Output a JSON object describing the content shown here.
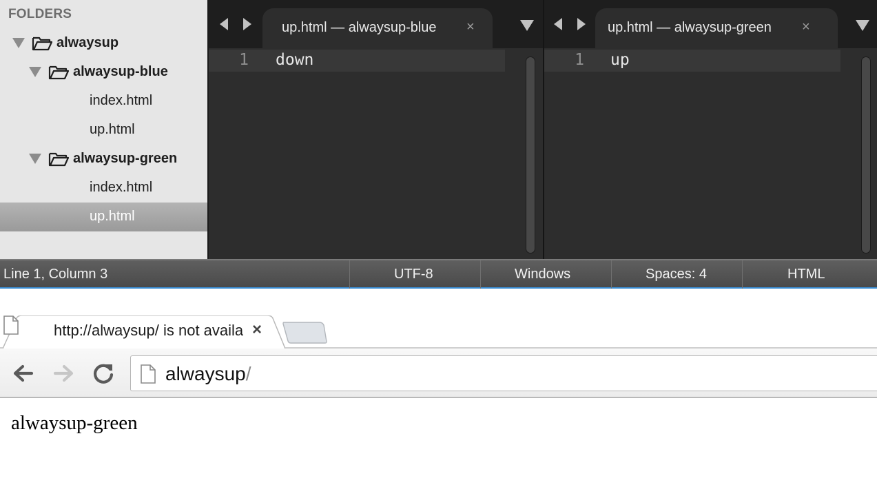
{
  "editor": {
    "sidebar": {
      "heading": "FOLDERS",
      "tree": [
        {
          "label": "alwaysup",
          "type": "folder",
          "expanded": true,
          "depth": 0
        },
        {
          "label": "alwaysup-blue",
          "type": "folder",
          "expanded": true,
          "depth": 1
        },
        {
          "label": "index.html",
          "type": "file",
          "depth": 2
        },
        {
          "label": "up.html",
          "type": "file",
          "depth": 2
        },
        {
          "label": "alwaysup-green",
          "type": "folder",
          "expanded": true,
          "depth": 1
        },
        {
          "label": "index.html",
          "type": "file",
          "depth": 2
        },
        {
          "label": "up.html",
          "type": "file",
          "depth": 2,
          "selected": true
        }
      ]
    },
    "panes": [
      {
        "tab_title": "up.html — alwaysup-blue",
        "close_glyph": "×",
        "line_number": "1",
        "code": "down"
      },
      {
        "tab_title": "up.html — alwaysup-green",
        "close_glyph": "×",
        "line_number": "1",
        "code": "up"
      }
    ],
    "statusbar": {
      "position": "Line 1, Column 3",
      "encoding": "UTF-8",
      "line_endings": "Windows",
      "indentation": "Spaces: 4",
      "syntax": "HTML"
    }
  },
  "browser": {
    "tab": {
      "title": "http://alwaysup/ is not available",
      "close_glyph": "×"
    },
    "omnibox": {
      "host": "alwaysup",
      "path": "/"
    },
    "page": {
      "text": "alwaysup-green"
    },
    "icons": [
      "back-arrow-icon",
      "forward-arrow-icon",
      "reload-icon",
      "page-icon"
    ]
  },
  "colors": {
    "editor_bg": "#2d2d2d",
    "sidebar_bg": "#e6e6e6",
    "selection": "#9e9e9e",
    "statusbar": "#525252",
    "accent": "#3a8fd6"
  }
}
